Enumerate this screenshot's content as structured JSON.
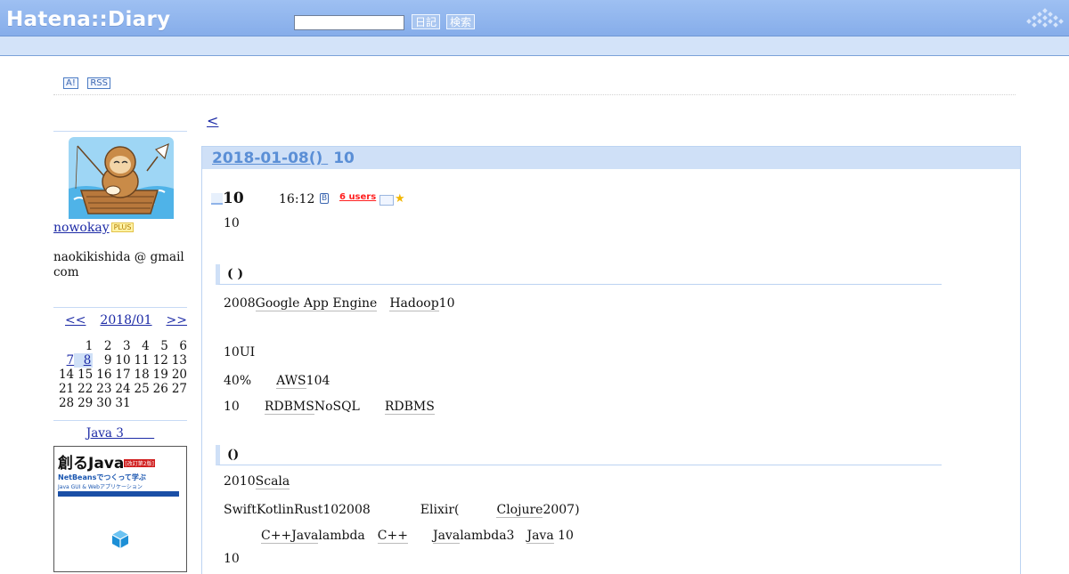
{
  "header": {
    "logo": "Hatena::Diary",
    "search_value": "",
    "diary_button": "日記",
    "search_button": "検索"
  },
  "header_links": {
    "antenna_label": "A!",
    "rss_label": "RSS"
  },
  "nav": {
    "prev_label": "<"
  },
  "sidebar": {
    "username": "nowokay",
    "plus_badge": "PLUS",
    "email": "naokikishida @ gmail com",
    "calendar": {
      "prev_label": "<<",
      "month_label": "2018/01",
      "next_label": ">>",
      "rows": [
        [
          "",
          "1",
          "2",
          "3",
          "4",
          "5",
          "6"
        ],
        [
          "7",
          "8",
          "9",
          "10",
          "11",
          "12",
          "13"
        ],
        [
          "14",
          "15",
          "16",
          "17",
          "18",
          "19",
          "20"
        ],
        [
          "21",
          "22",
          "23",
          "24",
          "25",
          "26",
          "27"
        ],
        [
          "28",
          "29",
          "30",
          "31",
          "",
          "",
          ""
        ]
      ],
      "linked_days": [
        "7",
        "8"
      ],
      "today": "8"
    },
    "ad_title": "Java 3",
    "book": {
      "title": "創るJava",
      "tag": "[改訂第2版]",
      "subtitle": "NetBeansでつくって学ぶ",
      "subtitle2": "Java GUI & Webアプリケーション"
    }
  },
  "day": {
    "date": "2018-01-08()",
    "count": "10"
  },
  "entry": {
    "title": "10",
    "time": "16:12",
    "hatebu_icon": "B",
    "users": "6 users",
    "star": "★"
  },
  "body": {
    "p1": "10",
    "section1": "( )",
    "p2_a": "2008",
    "p2_link1": "Google App Engine",
    "p2_sp": "　",
    "p2_link2": "Hadoop",
    "p2_b": "10",
    "p3": "10UI",
    "p4_a": "40%　　",
    "p4_link": "AWS",
    "p4_b": "104",
    "p5_a": "10　　",
    "p5_link1": "RDBMS",
    "p5_b": "NoSQL　　",
    "p5_link2": "RDBMS",
    "section2": "()",
    "p6_a": "2010",
    "p6_link": "Scala",
    "p7_a": "SwiftKotlinRust102008　　　　Elixir(　　　",
    "p7_link": "Clojure",
    "p7_b": "2007)",
    "p8_a": "　　　",
    "p8_link1": "C++",
    "p8_link2": "Java",
    "p8_b": "lambda　",
    "p8_link3": "C++",
    "p8_c": "　　",
    "p8_link4": "Java",
    "p8_d": "lambda3　",
    "p8_link5": "Java",
    "p8_e": " 10",
    "p9": "10"
  }
}
